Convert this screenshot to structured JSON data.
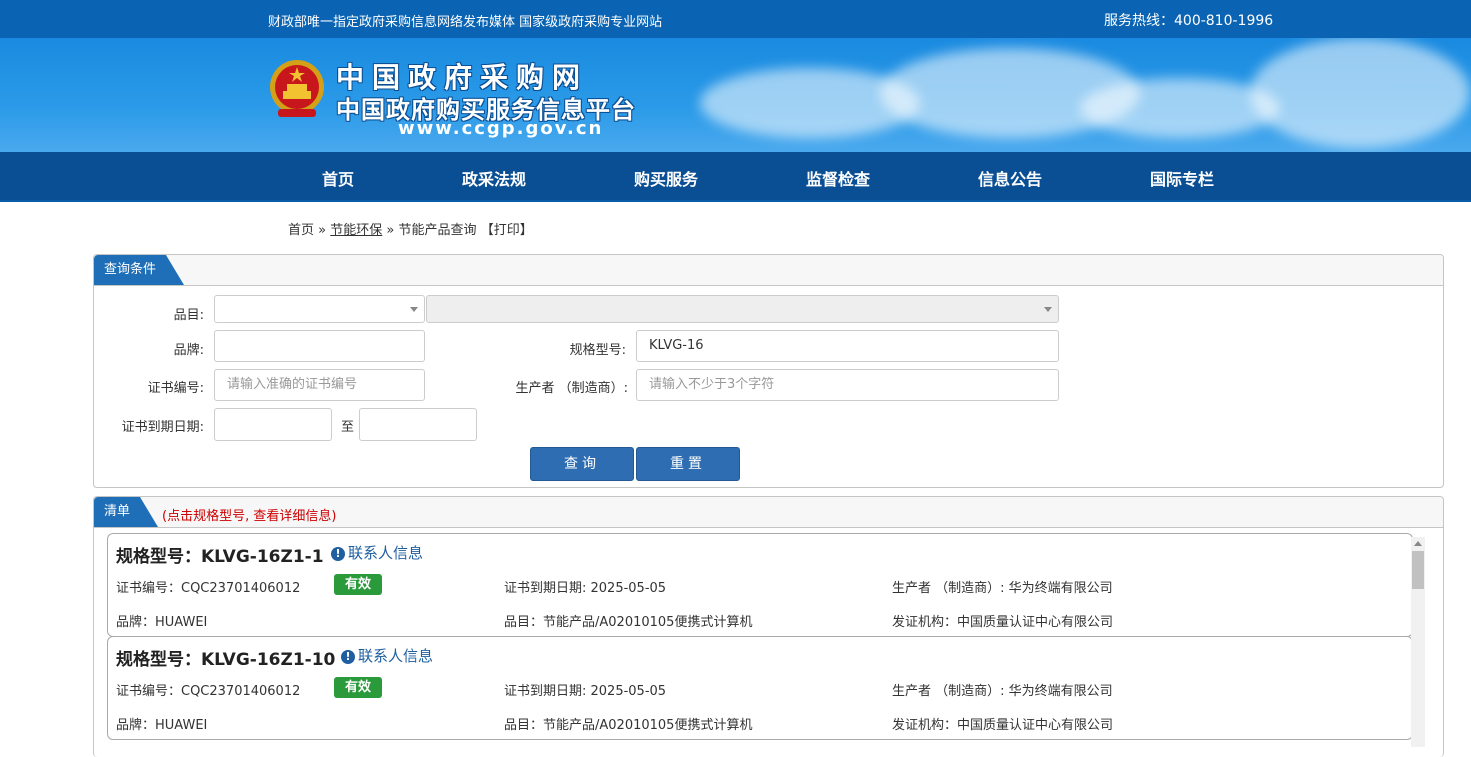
{
  "topbar": {
    "slogan": "财政部唯一指定政府采购信息网络发布媒体 国家级政府采购专业网站",
    "hotline": "服务热线：400-810-1996"
  },
  "banner": {
    "line1": "中国政府采购网",
    "line2": "中国政府购买服务信息平台",
    "url": "www.ccgp.gov.cn"
  },
  "nav": [
    "首页",
    "政采法规",
    "购买服务",
    "监督检查",
    "信息公告",
    "国际专栏"
  ],
  "breadcrumb": {
    "home": "首页",
    "sep1": "»",
    "section": "节能环保",
    "sep2": "»",
    "page": "节能产品查询",
    "print": "【打印】"
  },
  "query": {
    "tab": "查询条件",
    "category_label": "品目:",
    "brand_label": "品牌:",
    "model_label": "规格型号:",
    "model_value": "KLVG-16",
    "cert_label": "证书编号:",
    "cert_placeholder": "请输入准确的证书编号",
    "maker_label": "生产者 （制造商）:",
    "maker_placeholder": "请输入不少于3个字符",
    "expiry_label": "证书到期日期:",
    "to": "至",
    "search_btn": "查询",
    "reset_btn": "重置"
  },
  "list": {
    "tab": "清单",
    "hint": "(点击规格型号, 查看详细信息)",
    "contact_label": "联系人信息",
    "items": [
      {
        "title": "规格型号：KLVG-16Z1-1",
        "cert": "证书编号：CQC23701406012",
        "status": "有效",
        "expiry": "证书到期日期: 2025-05-05",
        "maker": "生产者 （制造商）: 华为终端有限公司",
        "brand": "品牌：HUAWEI",
        "category": "品目：节能产品/A02010105便携式计算机",
        "issuer": "发证机构：中国质量认证中心有限公司"
      },
      {
        "title": "规格型号：KLVG-16Z1-10",
        "cert": "证书编号：CQC23701406012",
        "status": "有效",
        "expiry": "证书到期日期: 2025-05-05",
        "maker": "生产者 （制造商）: 华为终端有限公司",
        "brand": "品牌：HUAWEI",
        "category": "品目：节能产品/A02010105便携式计算机",
        "issuer": "发证机构：中国质量认证中心有限公司"
      }
    ]
  },
  "colors": {
    "nav": "#0a4f94",
    "topbar": "#0a64b3",
    "button": "#2e6db2",
    "valid": "#2a9a3a"
  }
}
